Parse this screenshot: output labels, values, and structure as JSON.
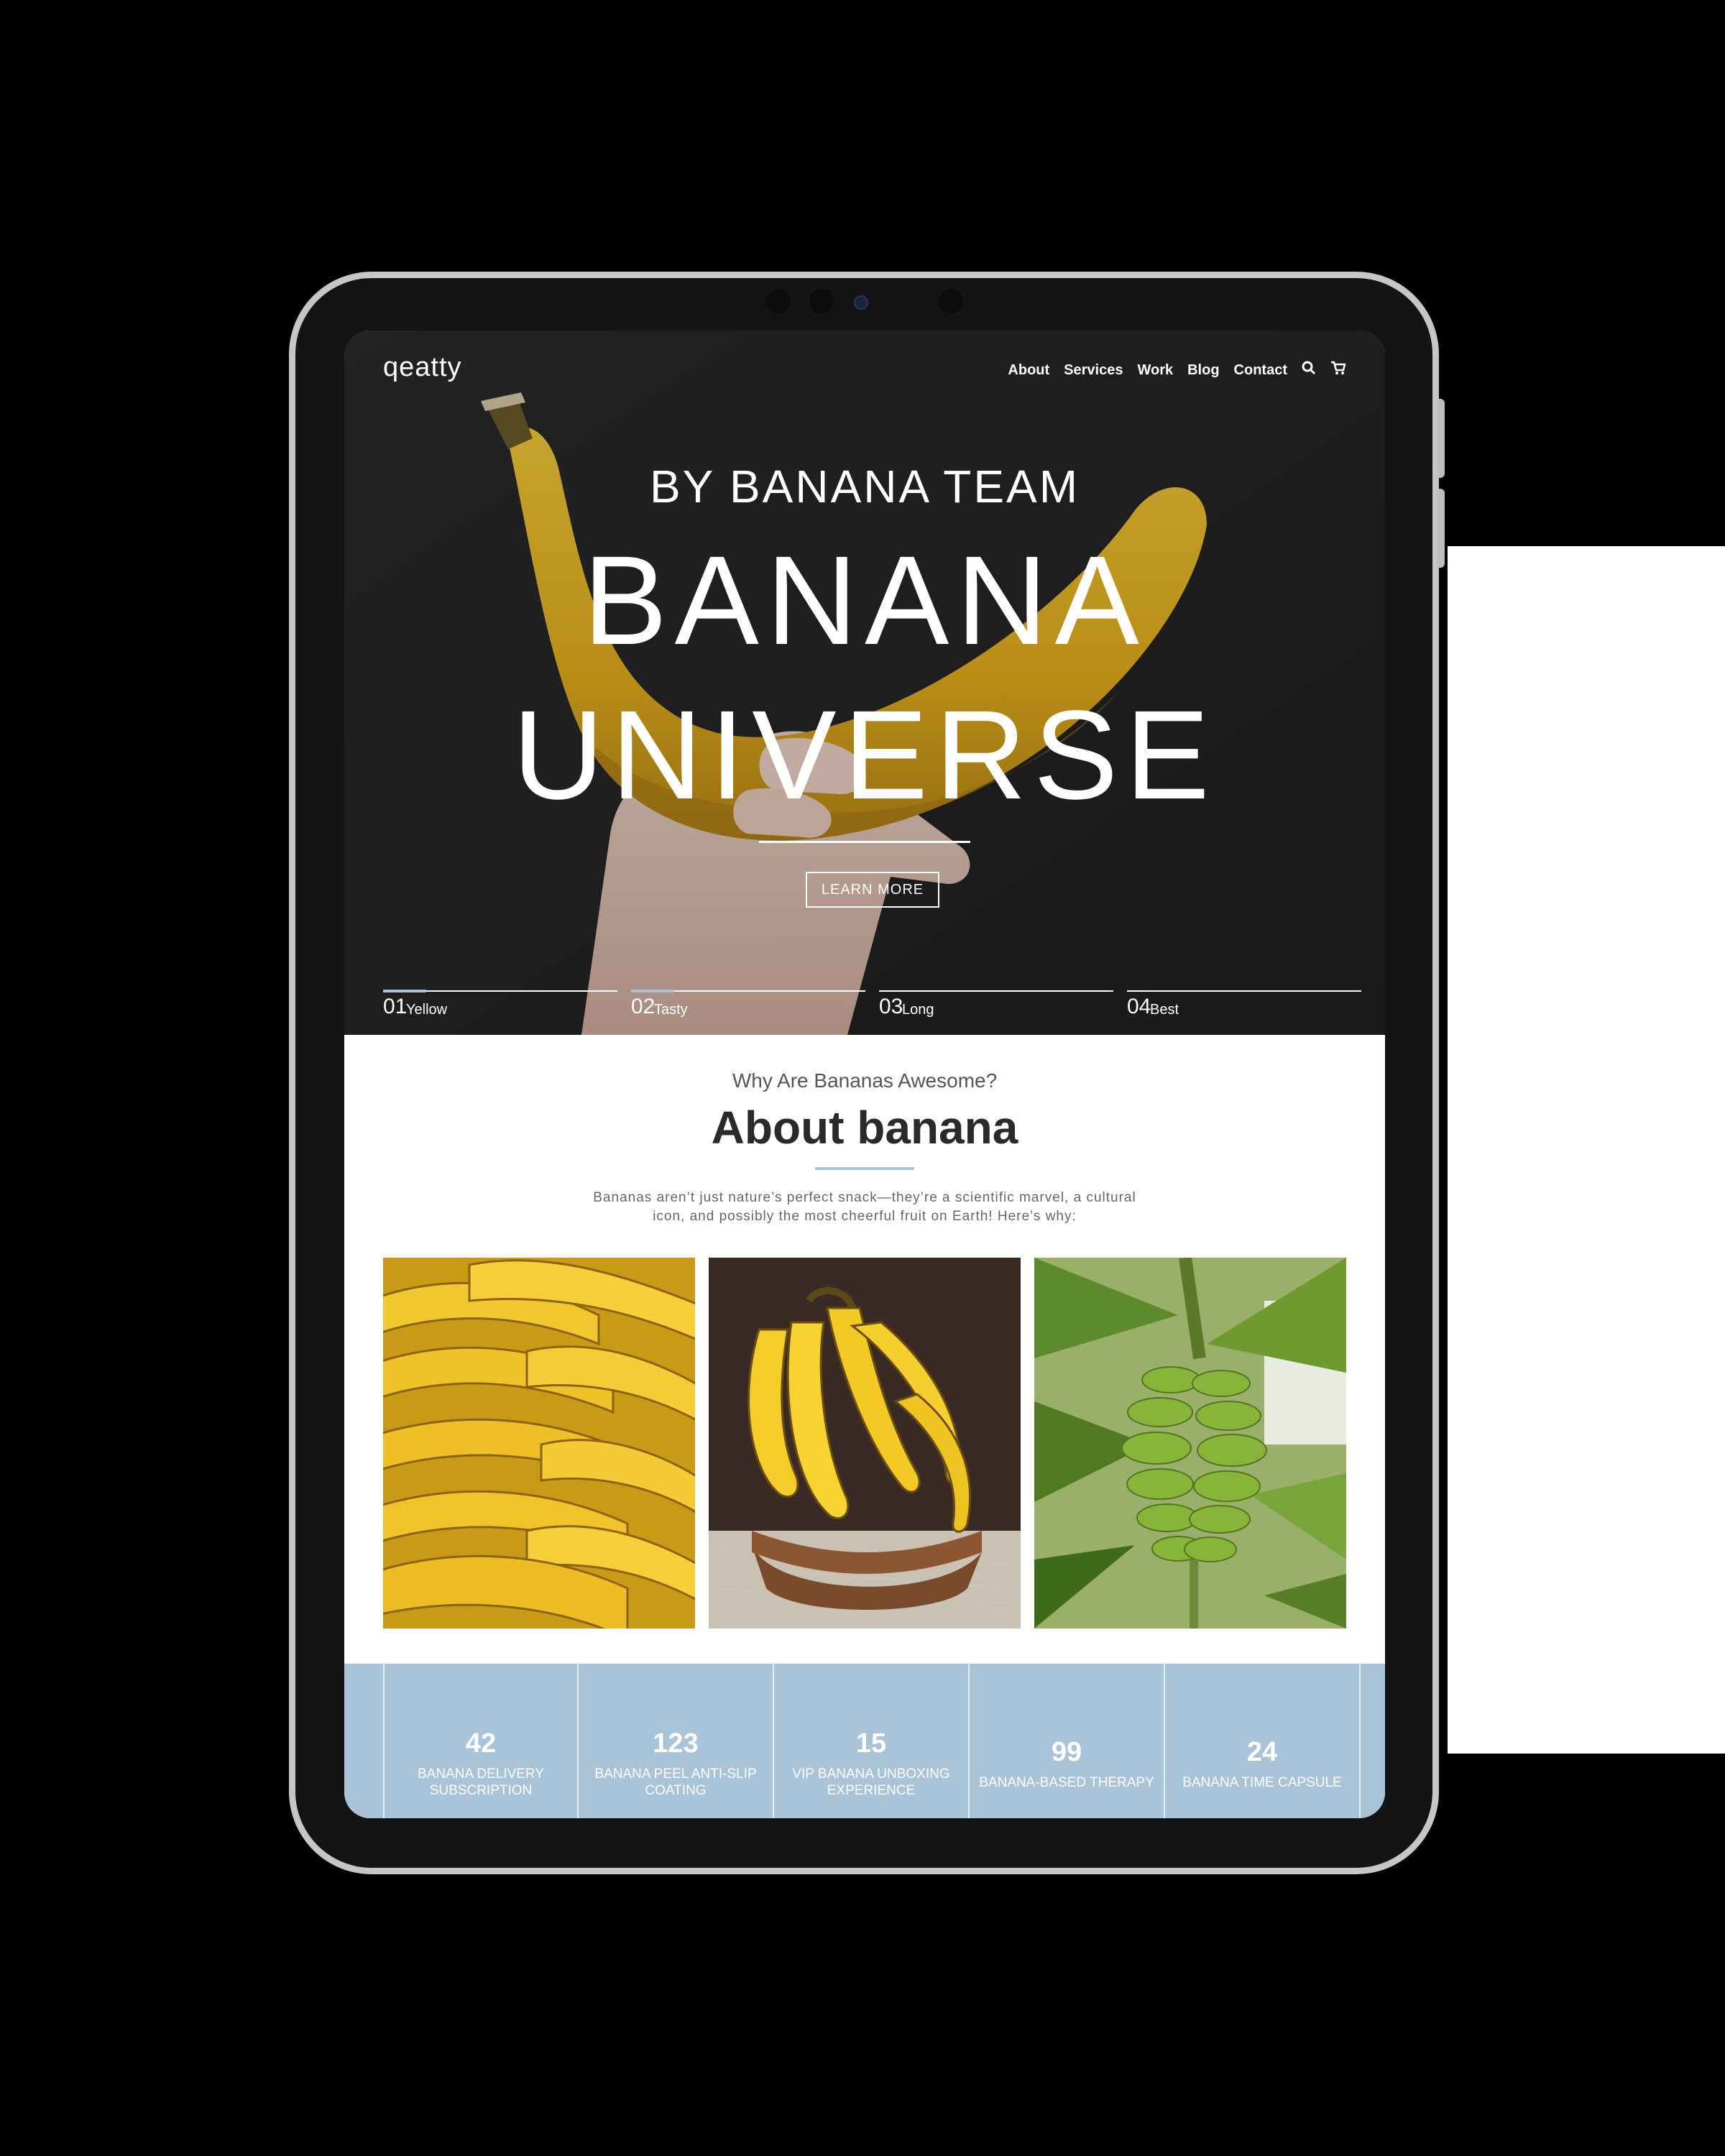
{
  "nav": {
    "logo": "qeatty",
    "links": [
      "About",
      "Services",
      "Work",
      "Blog",
      "Contact"
    ],
    "search_icon": "search-icon",
    "cart_icon": "cart-icon"
  },
  "hero": {
    "kicker": "BY BANANA TEAM",
    "title_line1": "BANANA",
    "title_line2": "UNIVERSE",
    "cta": "LEARN MORE",
    "slides": [
      {
        "num": "01",
        "label": "Yellow"
      },
      {
        "num": "02",
        "label": "Tasty"
      },
      {
        "num": "03",
        "label": "Long"
      },
      {
        "num": "04",
        "label": "Best"
      }
    ]
  },
  "about": {
    "kicker": "Why Are Bananas Awesome?",
    "title": "About banana",
    "text": "Bananas aren’t just nature’s perfect snack—they’re a scientific marvel, a cultural icon, and possibly the most cheerful fruit on Earth! Here’s why:"
  },
  "stats": [
    {
      "value": "42",
      "label": "BANANA DELIVERY SUBSCRIPTION"
    },
    {
      "value": "123",
      "label": "BANANA PEEL ANTI-SLIP COATING"
    },
    {
      "value": "15",
      "label": "VIP BANANA UNBOXING EXPERIENCE"
    },
    {
      "value": "99",
      "label": "BANANA-BASED THERAPY"
    },
    {
      "value": "24",
      "label": "BANANA TIME CAPSULE"
    }
  ],
  "colors": {
    "accent": "#a9c3d9",
    "hero_bg": "#262626",
    "banana": "#e9b91f"
  }
}
